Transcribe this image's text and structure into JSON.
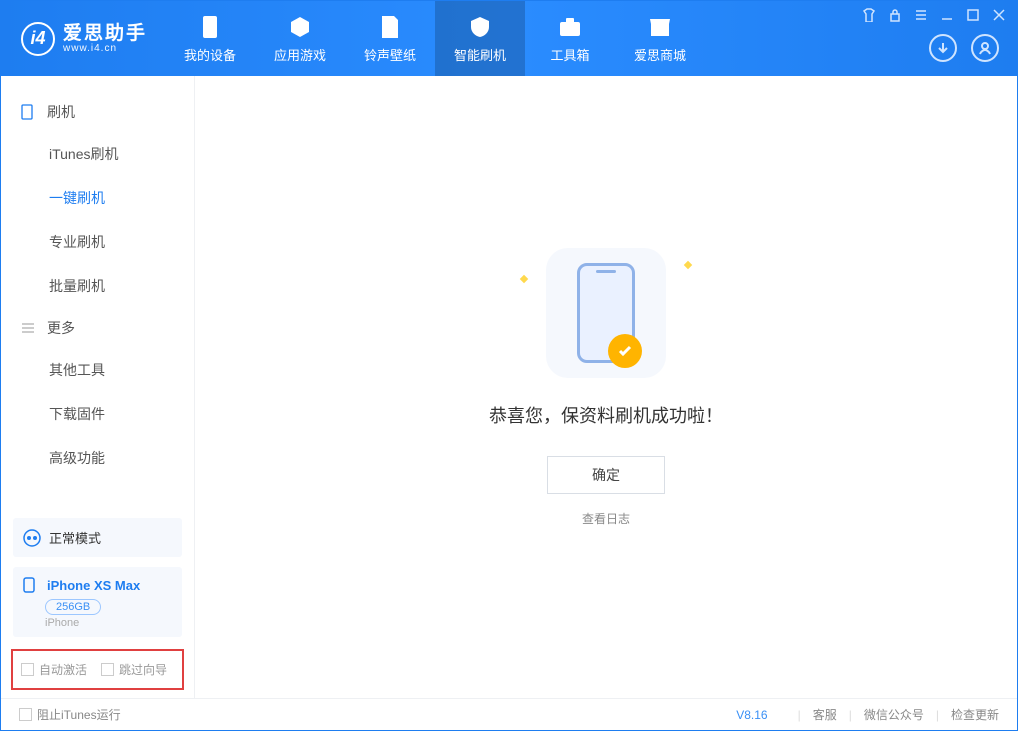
{
  "brand": {
    "name": "爱思助手",
    "site": "www.i4.cn"
  },
  "nav": {
    "items": [
      {
        "label": "我的设备"
      },
      {
        "label": "应用游戏"
      },
      {
        "label": "铃声壁纸"
      },
      {
        "label": "智能刷机"
      },
      {
        "label": "工具箱"
      },
      {
        "label": "爱思商城"
      }
    ],
    "active_index": 3
  },
  "sidebar": {
    "sections": [
      {
        "title": "刷机",
        "items": [
          "iTunes刷机",
          "一键刷机",
          "专业刷机",
          "批量刷机"
        ],
        "active_index": 1
      },
      {
        "title": "更多",
        "items": [
          "其他工具",
          "下载固件",
          "高级功能"
        ]
      }
    ],
    "status": "正常模式",
    "device": {
      "name": "iPhone XS Max",
      "capacity": "256GB",
      "type": "iPhone"
    },
    "options": {
      "auto_activate": "自动激活",
      "skip_guide": "跳过向导"
    }
  },
  "main": {
    "success_text": "恭喜您，保资料刷机成功啦！",
    "ok_button": "确定",
    "view_log": "查看日志"
  },
  "footer": {
    "block_itunes": "阻止iTunes运行",
    "version": "V8.16",
    "links": [
      "客服",
      "微信公众号",
      "检查更新"
    ]
  }
}
